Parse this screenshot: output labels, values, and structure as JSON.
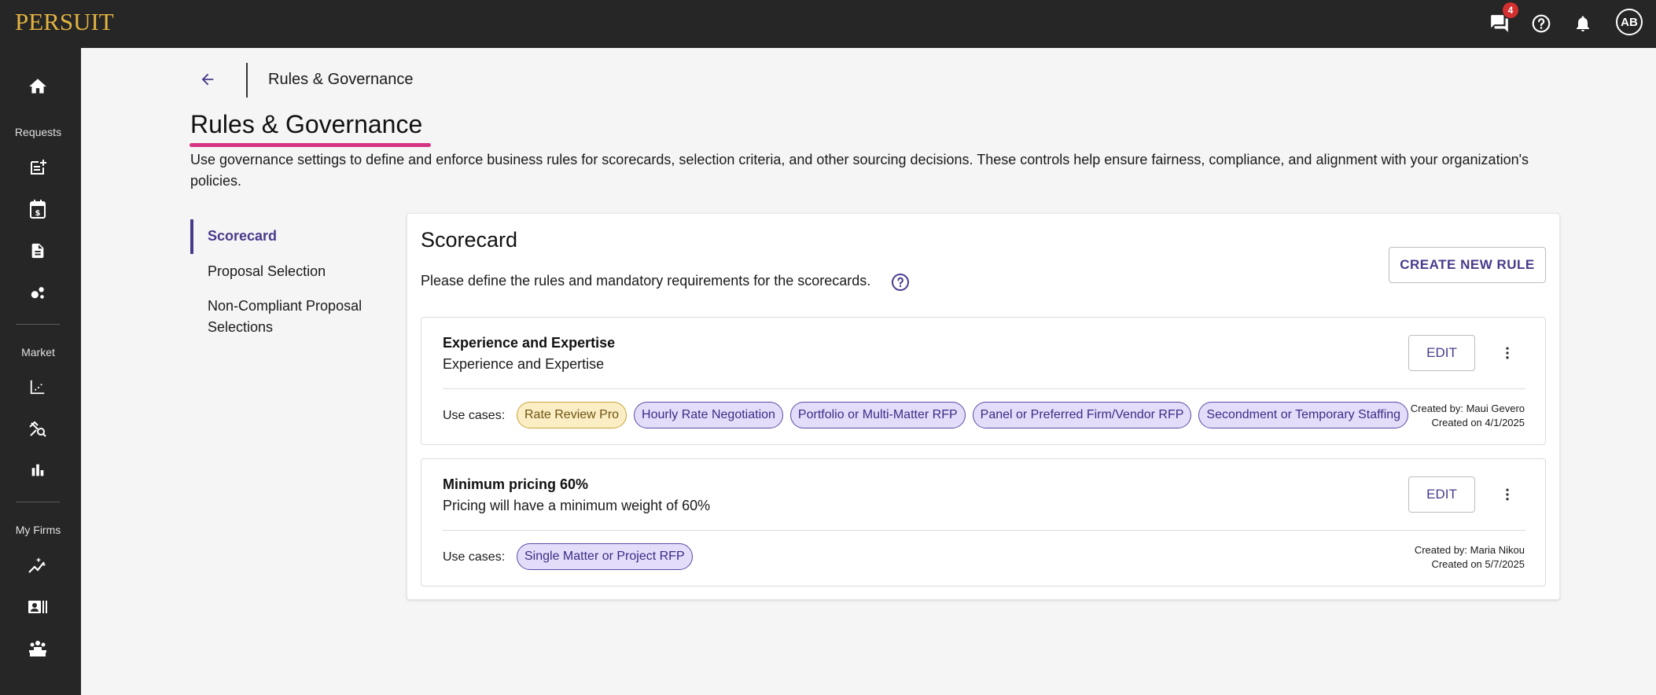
{
  "app": {
    "logo": "PERSUIT",
    "notifications_count": "4",
    "avatar_initials": "AB",
    "colors": {
      "accent": "#4a3a8c",
      "brand_gold": "#e3b341",
      "underline_pink": "#d63384",
      "topbar_bg": "#262626"
    }
  },
  "sidebar": {
    "home_icon": "home-icon",
    "sections": [
      {
        "label": "Requests",
        "icons": [
          "new-request-icon",
          "billing-calendar-icon",
          "document-icon",
          "workflow-icon"
        ]
      },
      {
        "label": "Market",
        "icons": [
          "trend-chart-icon",
          "market-search-icon",
          "bar-chart-icon"
        ]
      },
      {
        "label": "My Firms",
        "icons": [
          "firm-analytics-icon",
          "firm-card-icon",
          "firm-group-icon"
        ]
      }
    ]
  },
  "breadcrumb": {
    "current": "Rules & Governance"
  },
  "page": {
    "title": "Rules & Governance",
    "intro": "Use governance settings to define and enforce business rules for scorecards, selection criteria, and other sourcing decisions. These controls help ensure fairness, compliance, and alignment with your organization's policies."
  },
  "subnav": {
    "items": [
      {
        "label": "Scorecard",
        "active": true
      },
      {
        "label": "Proposal Selection",
        "active": false
      },
      {
        "label": "Non-Compliant Proposal Selections",
        "active": false
      }
    ]
  },
  "scorecard": {
    "title": "Scorecard",
    "description": "Please define the rules and mandatory requirements for the scorecards.",
    "create_label": "CREATE NEW RULE",
    "edit_label": "EDIT",
    "use_cases_label": "Use cases:",
    "rules": [
      {
        "title": "Experience and Expertise",
        "description": "Experience and Expertise",
        "use_cases": [
          {
            "label": "Rate Review Pro",
            "color": "#fbeec4"
          },
          {
            "label": "Hourly Rate Negotiation",
            "color": "#e4ddfa"
          },
          {
            "label": "Portfolio or Multi-Matter RFP",
            "color": "#e4ddfa"
          },
          {
            "label": "Panel or Preferred Firm/Vendor RFP",
            "color": "#e4ddfa"
          },
          {
            "label": "Secondment or Temporary Staffing",
            "color": "#e4ddfa"
          }
        ],
        "created_by": "Created by: Maui Gevero",
        "created_on": "Created on 4/1/2025"
      },
      {
        "title": "Minimum pricing 60%",
        "description": "Pricing will have a minimum weight of 60%",
        "use_cases": [
          {
            "label": "Single Matter or Project RFP",
            "color": "#e4ddfa"
          }
        ],
        "created_by": "Created by: Maria Nikou",
        "created_on": "Created on 5/7/2025"
      }
    ]
  }
}
